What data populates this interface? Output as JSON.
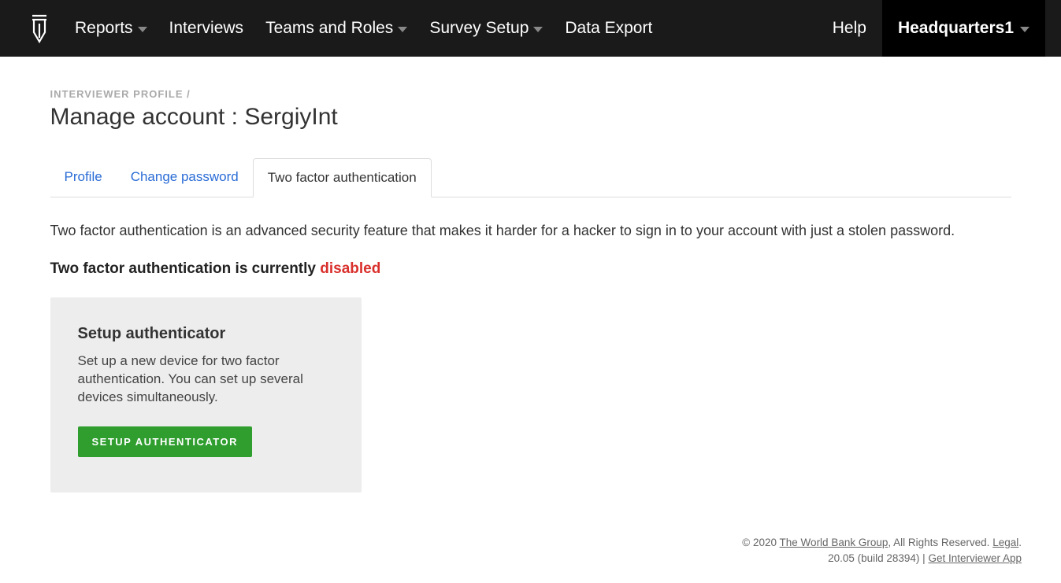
{
  "nav": {
    "items": [
      "Reports",
      "Interviews",
      "Teams and Roles",
      "Survey Setup",
      "Data Export"
    ],
    "help": "Help",
    "user": "Headquarters1"
  },
  "breadcrumb": "INTERVIEWER PROFILE /",
  "page_title_prefix": "Manage account : ",
  "page_title_name": "SergiyInt",
  "tabs": {
    "profile": "Profile",
    "change_password": "Change password",
    "twofa": "Two factor authentication"
  },
  "main": {
    "desc": "Two factor authentication is an advanced security feature that makes it harder for a hacker to sign in to your account with just a stolen password.",
    "status_prefix": "Two factor authentication is currently ",
    "status_value": "disabled",
    "card": {
      "title": "Setup authenticator",
      "body": "Set up a new device for two factor authentication. You can set up several devices simultaneously.",
      "button": "SETUP AUTHENTICATOR"
    }
  },
  "footer": {
    "copyright_prefix": "© 2020 ",
    "org": "The World Bank Group",
    "rights": ", All Rights Reserved. ",
    "legal": "Legal",
    "period": ".",
    "version": "20.05 (build 28394) | ",
    "app_link": "Get Interviewer App"
  }
}
